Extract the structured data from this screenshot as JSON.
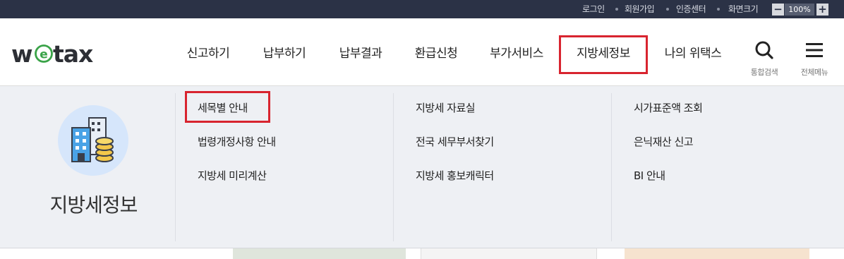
{
  "util_bar": {
    "login": "로그인",
    "signup": "회원가입",
    "cert_center": "인증센터",
    "zoom_label": "화면크기",
    "zoom_out": "−",
    "zoom_value": "100%",
    "zoom_in": "+"
  },
  "logo": {
    "text": "wetax",
    "accent_letter": "e"
  },
  "gnb": {
    "items": [
      "신고하기",
      "납부하기",
      "납부결과",
      "환급신청",
      "부가서비스",
      "지방세정보",
      "나의 위택스"
    ],
    "active": "지방세정보"
  },
  "tools": {
    "search_label": "통합검색",
    "menu_label": "전체메뉴"
  },
  "dropdown": {
    "title": "지방세정보",
    "columns": [
      [
        "세목별 안내",
        "법령개정사항 안내",
        "지방세 미리계산"
      ],
      [
        "지방세 자료실",
        "전국 세무부서찾기",
        "지방세 홍보캐릭터"
      ],
      [
        "시가표준액 조회",
        "은닉재산 신고",
        "BI 안내"
      ]
    ],
    "highlighted": "세목별 안내"
  },
  "colors": {
    "topbar_bg": "#2b3246",
    "highlight": "#d8242f",
    "logo_accent": "#3aa348",
    "panel_bg": "#eef0f4"
  },
  "icons": {
    "search": "search-icon",
    "menu": "hamburger-menu-icon",
    "category": "building-coins-icon"
  }
}
